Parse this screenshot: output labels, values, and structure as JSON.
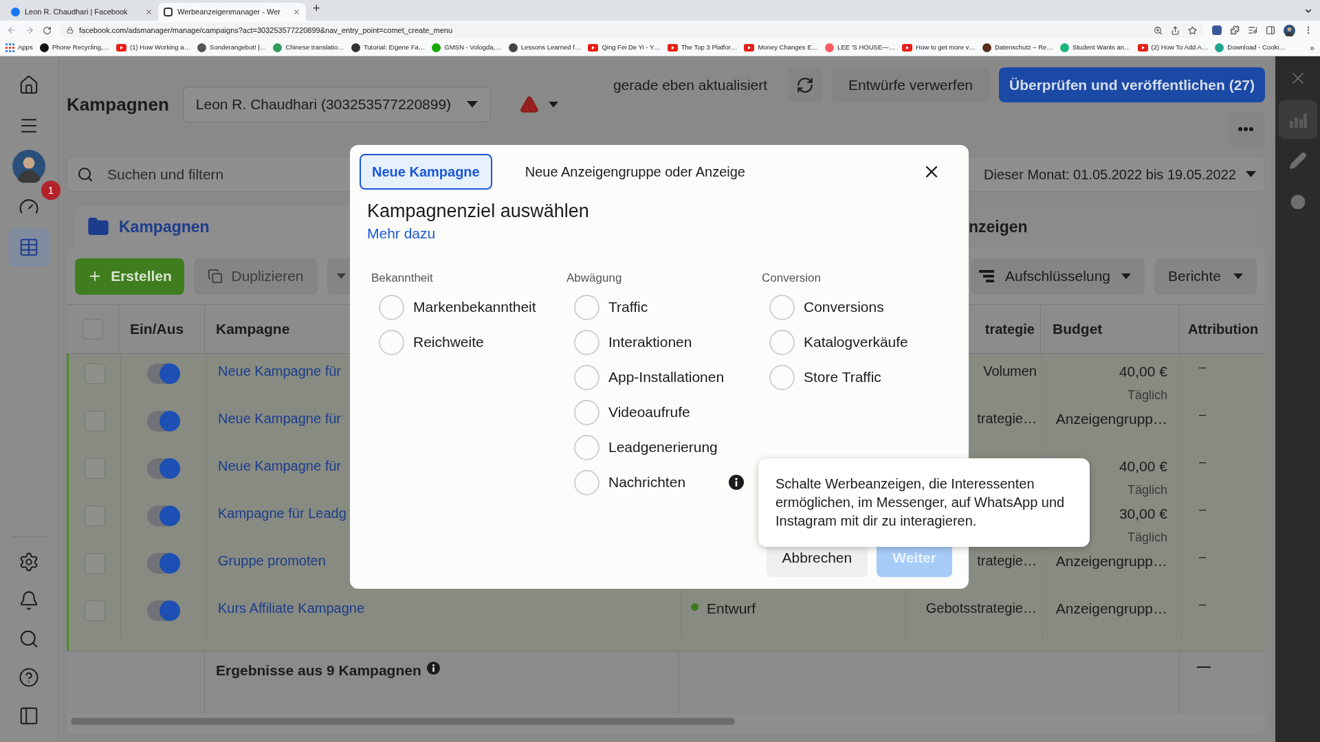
{
  "browser": {
    "tabs": [
      {
        "title": "Leon R. Chaudhari | Facebook",
        "selected": false
      },
      {
        "title": "Werbeanzeigenmanager - Wer",
        "selected": true
      }
    ],
    "new_tab": "+",
    "url": "facebook.com/adsmanager/manage/campaigns?act=303253577220899&nav_entry_point=comet_create_menu",
    "bookmarks": [
      {
        "label": "Apps",
        "kind": "apps",
        "color": "#4285f4"
      },
      {
        "label": "Phone Recycling,…",
        "kind": "site",
        "color": "#111111"
      },
      {
        "label": "(1) How Working a…",
        "kind": "video",
        "color": "#e62117"
      },
      {
        "label": "Sonderangebot! |…",
        "kind": "site",
        "color": "#555555"
      },
      {
        "label": "Chinese translatio…",
        "kind": "site",
        "color": "#2f9e5b"
      },
      {
        "label": "Tutorial: Eigene Fa…",
        "kind": "site",
        "color": "#333333"
      },
      {
        "label": "GMSN - Vologda,…",
        "kind": "site",
        "color": "#14a800"
      },
      {
        "label": "Lessons Learned f…",
        "kind": "site",
        "color": "#444444"
      },
      {
        "label": "Qing Fei De Yi - Y…",
        "kind": "video",
        "color": "#e62117"
      },
      {
        "label": "The Top 3 Platfor…",
        "kind": "video",
        "color": "#e62117"
      },
      {
        "label": "Money Changes E…",
        "kind": "video",
        "color": "#e62117"
      },
      {
        "label": "LEE 'S HOUSE—…",
        "kind": "site",
        "color": "#ff5a5f"
      },
      {
        "label": "How to get more v…",
        "kind": "video",
        "color": "#e62117"
      },
      {
        "label": "Datenschutz – Re…",
        "kind": "site",
        "color": "#5a2a1a"
      },
      {
        "label": "Student Wants an…",
        "kind": "site",
        "color": "#1fb57a"
      },
      {
        "label": "(2) How To Add A…",
        "kind": "video",
        "color": "#e62117"
      },
      {
        "label": "Download - Cooki…",
        "kind": "site",
        "color": "#1fa58f"
      }
    ],
    "more_bookmarks": "»"
  },
  "sidebar": {
    "items": [
      {
        "kind": "home",
        "selected": false
      },
      {
        "kind": "menu",
        "selected": false
      },
      {
        "kind": "avatar",
        "selected": false
      },
      {
        "kind": "gauge",
        "selected": false,
        "badge": "1"
      },
      {
        "kind": "table",
        "selected": true
      }
    ],
    "bottom_items": [
      {
        "kind": "settings",
        "selected": false
      },
      {
        "kind": "bell",
        "selected": false
      },
      {
        "kind": "search",
        "selected": false
      },
      {
        "kind": "help",
        "selected": false
      },
      {
        "kind": "panel",
        "selected": false
      }
    ]
  },
  "header": {
    "title": "Kampagnen",
    "account": "Leon R. Chaudhari (303253577220899)",
    "status": "gerade eben aktualisiert",
    "discard": "Entwürfe verwerfen",
    "publish": "Überprüfen und veröffentlichen (27)"
  },
  "search": {
    "placeholder": "Suchen und filtern",
    "date_range": "Dieser Monat: 01.05.2022 bis 19.05.2022"
  },
  "level_tabs": [
    {
      "label": "Kampagnen",
      "selected": true
    },
    {
      "label": "nzeigen",
      "selected": false
    }
  ],
  "toolbar": {
    "create": "Erstellen",
    "duplicate": "Duplizieren",
    "breakdown": "Aufschlüsselung",
    "reports": "Berichte"
  },
  "table": {
    "select_all_checked": false,
    "columns": [
      "Ein/Aus",
      "Kampagne",
      "trategie",
      "Budget",
      "Attribution"
    ],
    "rows": [
      {
        "checked": false,
        "on": true,
        "name": "Neue Kampagne für",
        "strategy": "Volumen",
        "budget": "40,00 €",
        "budget_note": "Täglich",
        "attribution": "–"
      },
      {
        "checked": false,
        "on": true,
        "name": "Neue Kampagne für",
        "strategy": "trategie…",
        "budget": "Anzeigengrupp…",
        "attribution": "–"
      },
      {
        "checked": false,
        "on": true,
        "name": "Neue Kampagne für",
        "budget": "40,00 €",
        "budget_note": "Täglich",
        "attribution": "–"
      },
      {
        "checked": false,
        "on": true,
        "name": "Kampagne für Leadg",
        "budget": "30,00 €",
        "budget_note": "Täglich",
        "attribution": "–"
      },
      {
        "checked": false,
        "on": true,
        "name": "Gruppe promoten",
        "strategy": "trategie…",
        "budget": "Anzeigengrupp…",
        "attribution": "–"
      },
      {
        "checked": false,
        "on": true,
        "name": "Kurs Affiliate Kampagne",
        "status": "Entwurf",
        "color": "#3d7a1c",
        "strategy": "Gebotsstrategie…",
        "budget": "Anzeigengrupp…",
        "attribution": "–"
      }
    ],
    "footer": {
      "label": "Ergebnisse aus 9 Kampagnen",
      "attribution": "—"
    }
  },
  "right_rail": {
    "items": [
      {
        "kind": "close",
        "selected": false
      },
      {
        "kind": "chart",
        "selected": true
      },
      {
        "kind": "edit",
        "selected": false
      },
      {
        "kind": "history",
        "selected": false
      }
    ]
  },
  "dialog": {
    "tabs": [
      {
        "label": "Neue Kampagne",
        "selected": true
      },
      {
        "label": "Neue Anzeigengruppe oder Anzeige",
        "selected": false
      }
    ],
    "title": "Kampagnenziel auswählen",
    "link": "Mehr dazu",
    "groups": [
      {
        "heading": "Bekanntheit",
        "options": [
          {
            "label": "Markenbekanntheit",
            "selected": false
          },
          {
            "label": "Reichweite",
            "selected": false
          }
        ]
      },
      {
        "heading": "Abwägung",
        "options": [
          {
            "label": "Traffic",
            "selected": false
          },
          {
            "label": "Interaktionen",
            "selected": false
          },
          {
            "label": "App-Installationen",
            "selected": false
          },
          {
            "label": "Videoaufrufe",
            "selected": false
          },
          {
            "label": "Leadgenerierung",
            "selected": false
          },
          {
            "label": "Nachrichten",
            "selected": false,
            "tooltip": "Schalte Werbeanzeigen, die Interessenten ermöglichen, im Messenger, auf WhatsApp und Instagram mit dir zu interagieren."
          }
        ]
      },
      {
        "heading": "Conversion",
        "options": [
          {
            "label": "Conversions",
            "selected": false
          },
          {
            "label": "Katalogverkäufe",
            "selected": false
          },
          {
            "label": "Store Traffic",
            "selected": false
          }
        ]
      }
    ],
    "buttons": [
      {
        "label": "Abbrechen",
        "kind": "secondary",
        "disabled": false
      },
      {
        "label": "Weiter",
        "kind": "primary",
        "disabled": true
      }
    ]
  }
}
